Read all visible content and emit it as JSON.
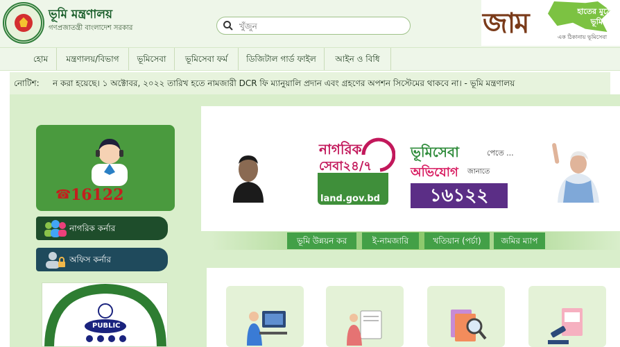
{
  "header": {
    "title": "ভূমি মন্ত্রণালয়",
    "subtitle": "গণপ্রজাতন্ত্রী বাংলাদেশ সরকার",
    "logo_text": "গণপ্রজাতন্ত্রী বাংলাদেশ সরকার"
  },
  "search": {
    "placeholder": "খুঁজুন"
  },
  "brand": {
    "mark": "জাম",
    "line1": "হাতের মুঠোয়",
    "line2": "ভূমিসেবা",
    "tagline": "এক ঠিকানায় ভূমিসেবা"
  },
  "nav": {
    "items": [
      {
        "label": "হোম"
      },
      {
        "label": "মন্ত্রণালয়/বিভাগ"
      },
      {
        "label": "ভূমিসেবা"
      },
      {
        "label": "ভূমিসেবা ফর্ম"
      },
      {
        "label": "ডিজিটাল গার্ড ফাইল"
      },
      {
        "label": "আইন ও বিধি"
      }
    ]
  },
  "notice": {
    "label": "নোটিশ:",
    "text": "ন করা হয়েছে। ১ অক্টোবর, ২০২২ তারিখ হতে নামজারী DCR ফি ম্যানুয়ালি প্রদান এবং গ্রহণের অপশন সিস্টেমের থাকবে না। - ভূমি মন্ত্রণালয়"
  },
  "sidebar": {
    "hotline_number": "16122",
    "citizen_corner": "নাগরিক কর্নার",
    "office_corner": "অফিস কর্নার",
    "certificate_text": "PUBLIC"
  },
  "banner": {
    "nagorik_line1": "নাগরিক",
    "nagorik_line2": "সেবা২৪/৭",
    "nagorik_url": "land.gov.bd",
    "bhumisheba": "ভূমিসেবা",
    "bhumisheba_suffix": "পেতে ...",
    "obhijog": "অভিযোগ",
    "obhijog_suffix": "জানাতে",
    "hotline_bn": "১৬১২২"
  },
  "services": [
    {
      "label": "ভূমি উন্নয়ন কর"
    },
    {
      "label": "ই-নামজারি"
    },
    {
      "label": "খতিয়ান (পর্চা)"
    },
    {
      "label": "জমির ম্যাপ"
    }
  ],
  "colors": {
    "primary_green": "#4a9a3e",
    "header_bg": "#eef6e9",
    "citizen_corner_bg": "#1e4d2b",
    "office_corner_bg": "#1f4a5c",
    "hotline_red": "#c41e1e",
    "hotline_purple": "#5b2e86"
  }
}
